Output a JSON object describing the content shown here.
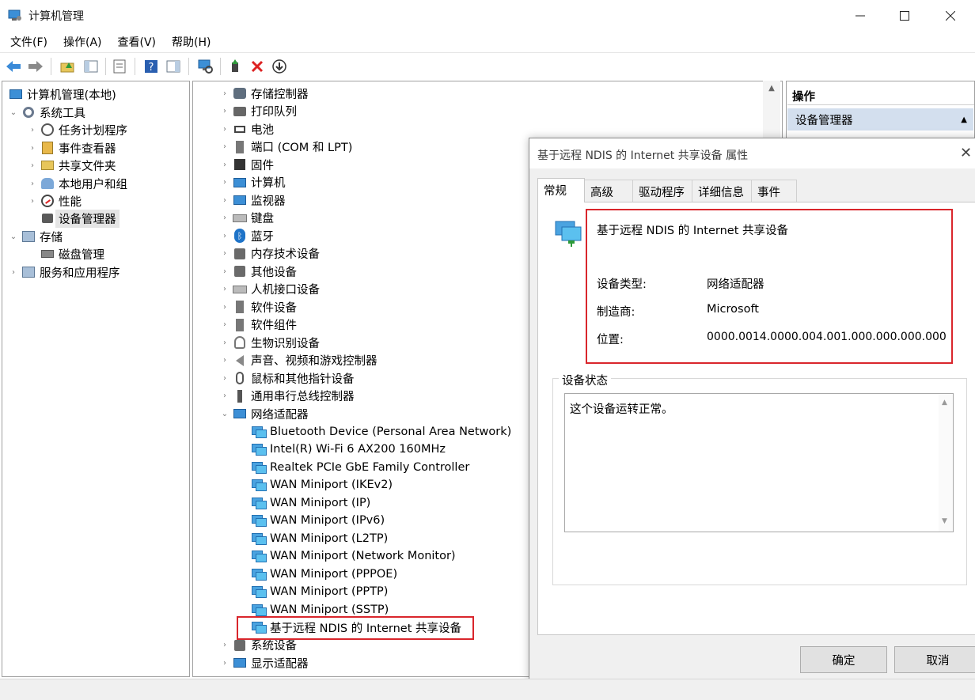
{
  "window": {
    "title": "计算机管理"
  },
  "menu": [
    "文件(F)",
    "操作(A)",
    "查看(V)",
    "帮助(H)"
  ],
  "tree": {
    "root": "计算机管理(本地)",
    "items": [
      {
        "label": "系统工具",
        "level": 1,
        "chev": "⌄"
      },
      {
        "label": "任务计划程序",
        "level": 2,
        "chev": "›"
      },
      {
        "label": "事件查看器",
        "level": 2,
        "chev": "›"
      },
      {
        "label": "共享文件夹",
        "level": 2,
        "chev": "›"
      },
      {
        "label": "本地用户和组",
        "level": 2,
        "chev": "›"
      },
      {
        "label": "性能",
        "level": 2,
        "chev": "›"
      },
      {
        "label": "设备管理器",
        "level": 2,
        "chev": ""
      },
      {
        "label": "存储",
        "level": 1,
        "chev": "⌄"
      },
      {
        "label": "磁盘管理",
        "level": 2,
        "chev": ""
      },
      {
        "label": "服务和应用程序",
        "level": 1,
        "chev": "›"
      }
    ]
  },
  "devices": {
    "categories_top": [
      "存储控制器",
      "打印队列",
      "电池",
      "端口 (COM 和 LPT)",
      "固件",
      "计算机",
      "监视器",
      "键盘",
      "蓝牙",
      "内存技术设备",
      "其他设备",
      "人机接口设备",
      "软件设备",
      "软件组件",
      "生物识别设备",
      "声音、视频和游戏控制器",
      "鼠标和其他指针设备",
      "通用串行总线控制器"
    ],
    "network_label": "网络适配器",
    "network_children": [
      "Bluetooth Device (Personal Area Network)",
      "Intel(R) Wi-Fi 6 AX200 160MHz",
      "Realtek PCIe GbE Family Controller",
      "WAN Miniport (IKEv2)",
      "WAN Miniport (IP)",
      "WAN Miniport (IPv6)",
      "WAN Miniport (L2TP)",
      "WAN Miniport (Network Monitor)",
      "WAN Miniport (PPPOE)",
      "WAN Miniport (PPTP)",
      "WAN Miniport (SSTP)",
      "基于远程 NDIS 的 Internet 共享设备"
    ],
    "categories_bottom": [
      "系统设备",
      "显示适配器"
    ]
  },
  "actions": {
    "title": "操作",
    "section": "设备管理器"
  },
  "dialog": {
    "title": "基于远程 NDIS 的 Internet 共享设备 属性",
    "tabs": [
      "常规",
      "高级",
      "驱动程序",
      "详细信息",
      "事件"
    ],
    "device_name": "基于远程 NDIS 的 Internet 共享设备",
    "type_label": "设备类型:",
    "type_value": "网络适配器",
    "mfr_label": "制造商:",
    "mfr_value": "Microsoft",
    "loc_label": "位置:",
    "loc_value": "0000.0014.0000.004.001.000.000.000.000",
    "status_legend": "设备状态",
    "status_text": "这个设备运转正常。",
    "ok": "确定",
    "cancel": "取消"
  },
  "colors": {
    "highlight": "#d9262c",
    "selection": "#e5e5e5",
    "actions_section": "#d3dfee"
  }
}
